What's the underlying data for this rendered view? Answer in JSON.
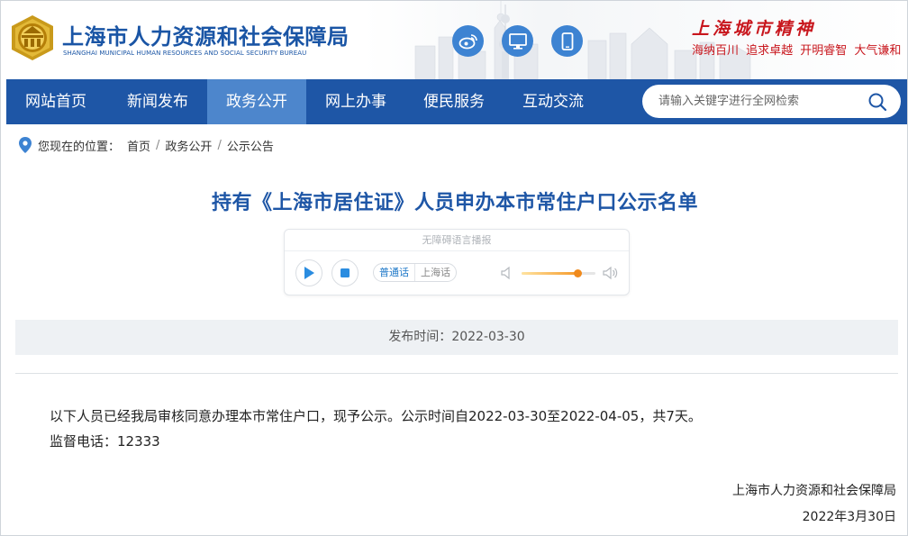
{
  "header": {
    "title": "上海市人力资源和社会保障局",
    "subtitle": "SHANGHAI MUNICIPAL HUMAN RESOURCES AND SOCIAL SECURITY BUREAU",
    "icons": [
      "weibo-icon",
      "desktop-icon",
      "mobile-icon"
    ],
    "spirit_title": "上海城市精神",
    "spirit_phrases": "海纳百川 追求卓越 开明睿智 大气谦和"
  },
  "nav": {
    "items": [
      {
        "label": "网站首页"
      },
      {
        "label": "新闻发布"
      },
      {
        "label": "政务公开"
      },
      {
        "label": "网上办事"
      },
      {
        "label": "便民服务"
      },
      {
        "label": "互动交流"
      }
    ],
    "active_index": 2,
    "search_placeholder": "请输入关键字进行全网检索"
  },
  "breadcrumb": {
    "prefix": "您现在的位置：",
    "items": [
      "首页",
      "政务公开",
      "公示公告"
    ],
    "separator": "/"
  },
  "article": {
    "title": "持有《上海市居住证》人员申办本市常住户口公示名单",
    "player": {
      "heading": "无障碍语言播报",
      "languages": [
        "普通话",
        "上海话"
      ],
      "active_language": "普通话",
      "volume": 0.75
    },
    "publish_label": "发布时间：",
    "publish_date": "2022-03-30",
    "paragraph": "以下人员已经我局审核同意办理本市常住户口，现予公示。公示时间自2022-03-30至2022-04-05，共7天。",
    "hotline": "监督电话：12333",
    "signature": "上海市人力资源和社会保障局",
    "sign_date": "2022年3月30日"
  },
  "colors": {
    "brand_blue": "#1e56a6",
    "nav_active": "#4d86cc",
    "accent_red": "#c8161d",
    "volume_orange": "#f08a1c"
  }
}
